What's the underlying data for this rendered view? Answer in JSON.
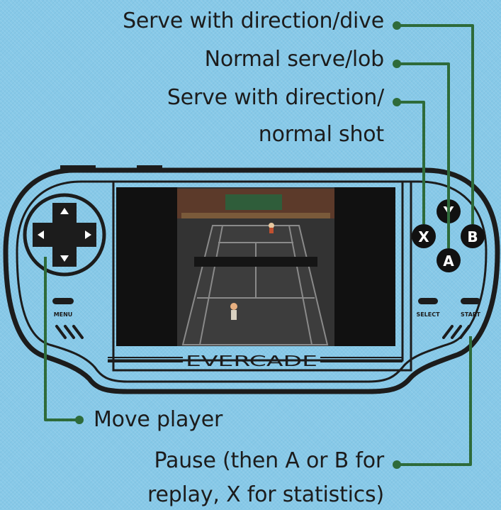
{
  "labels": {
    "serve_dive": "Serve with direction/dive",
    "normal_serve": "Normal serve/lob",
    "serve_normal_line1": "Serve with direction/",
    "serve_normal_line2": "normal shot",
    "move": "Move player",
    "pause_line1": "Pause (then A or B for",
    "pause_line2": "replay, X for statistics)"
  },
  "device": {
    "brand": "EVERCADE",
    "menu": "MENU",
    "select": "SELECT",
    "start": "START",
    "buttons": {
      "y": "Y",
      "x": "X",
      "a": "A",
      "b": "B"
    }
  },
  "colors": {
    "background": "#87c9e8",
    "outline": "#1c1c1c",
    "leader": "#2e6b3a",
    "court": "#3d3d3d"
  },
  "icons": {
    "dpad": "dpad-icon",
    "speaker": "speaker-grille-icon",
    "leader_dot": "leader-dot-icon"
  }
}
